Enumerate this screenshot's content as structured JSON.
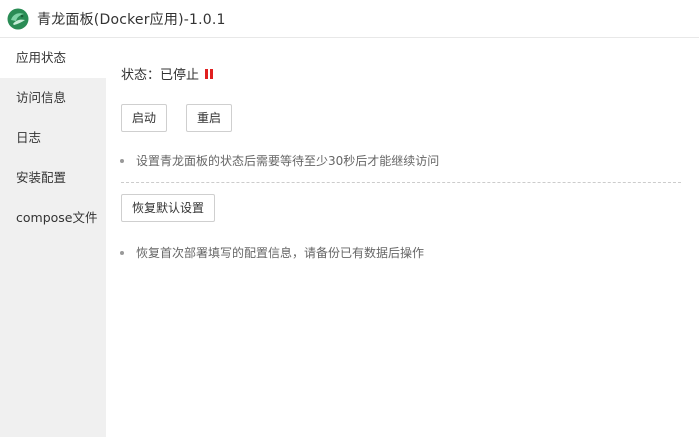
{
  "window": {
    "title": "青龙面板(Docker应用)-1.0.1",
    "logo_icon": "qinglong-logo-icon"
  },
  "sidebar": {
    "items": [
      {
        "label": "应用状态",
        "active": true
      },
      {
        "label": "访问信息",
        "active": false
      },
      {
        "label": "日志",
        "active": false
      },
      {
        "label": "安装配置",
        "active": false
      },
      {
        "label": "compose文件",
        "active": false
      }
    ]
  },
  "main": {
    "status_label": "状态：已停止",
    "status_icon": "pause-icon",
    "status_color": "#e02020",
    "start_button": "启动",
    "restart_button": "重启",
    "tip_restart": "设置青龙面板的状态后需要等待至少30秒后才能继续访问",
    "reset_button": "恢复默认设置",
    "tip_reset": "恢复首次部署填写的配置信息，请备份已有数据后操作"
  }
}
